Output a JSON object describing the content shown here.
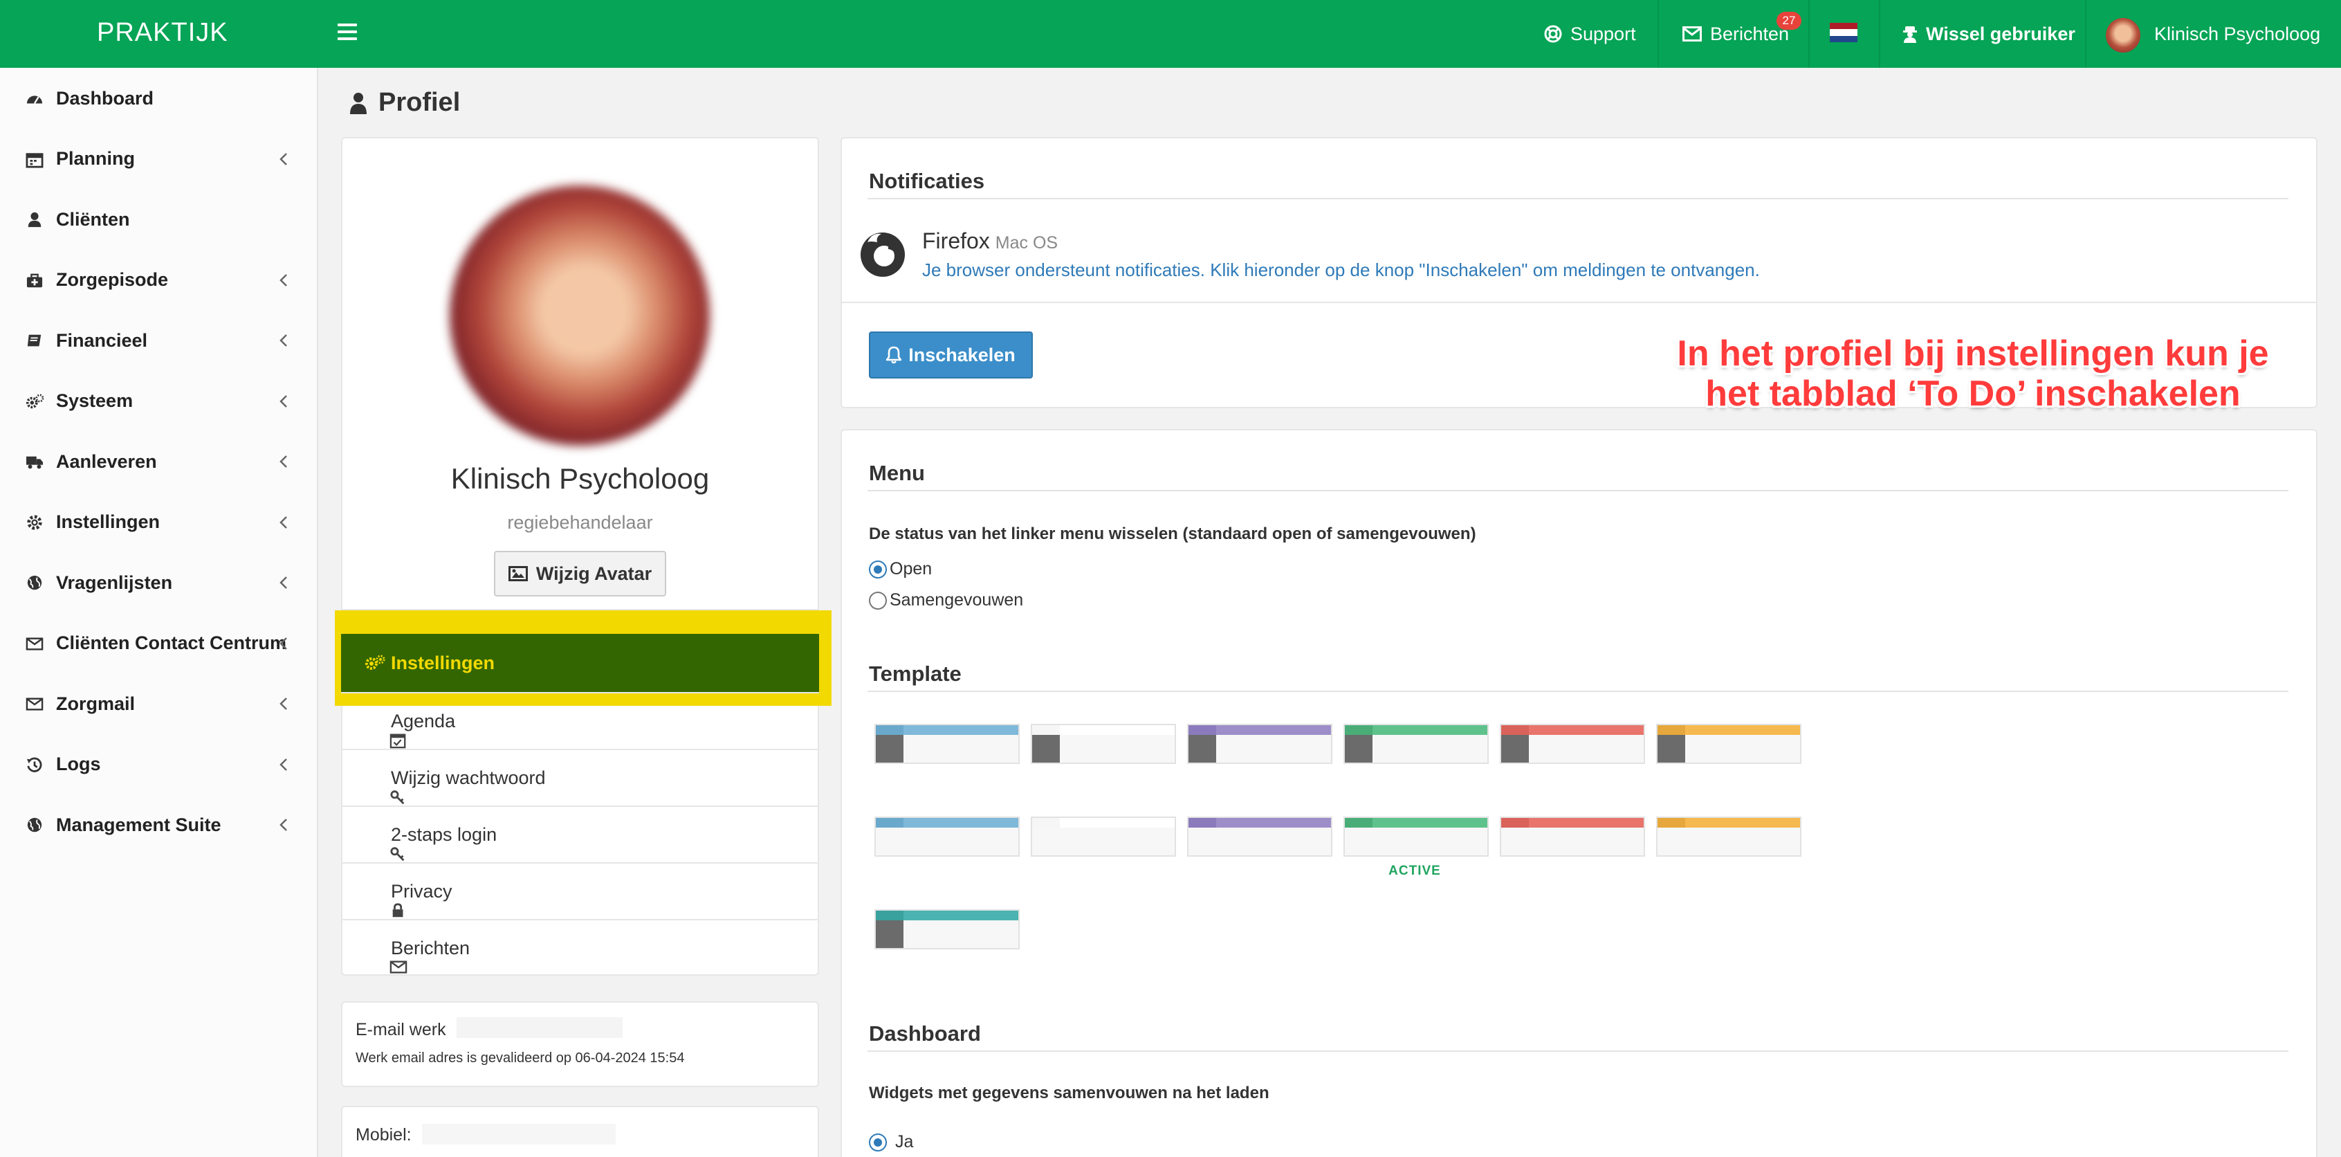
{
  "topbar": {
    "brand": "PRAKTIJK",
    "support_label": "Support",
    "messages_label": "Berichten",
    "messages_badge": "27",
    "switch_user_label": "Wissel gebruiker",
    "user_name": "Klinisch Psycholoog",
    "flag_colors": [
      "#ae1c28",
      "#ffffff",
      "#21468b"
    ]
  },
  "sidebar": {
    "items": [
      {
        "label": "Dashboard",
        "icon": "tachometer-icon",
        "has_chevron": false
      },
      {
        "label": "Planning",
        "icon": "calendar-icon",
        "has_chevron": true
      },
      {
        "label": "Cliënten",
        "icon": "user-icon",
        "has_chevron": false
      },
      {
        "label": "Zorgepisode",
        "icon": "medkit-icon",
        "has_chevron": true
      },
      {
        "label": "Financieel",
        "icon": "book-icon",
        "has_chevron": true
      },
      {
        "label": "Systeem",
        "icon": "cogs-icon",
        "has_chevron": true
      },
      {
        "label": "Aanleveren",
        "icon": "truck-icon",
        "has_chevron": true
      },
      {
        "label": "Instellingen",
        "icon": "gear-icon",
        "has_chevron": true
      },
      {
        "label": "Vragenlijsten",
        "icon": "globe-icon",
        "has_chevron": true
      },
      {
        "label": "Cliënten Contact Centrum",
        "icon": "envelope-icon",
        "has_chevron": true
      },
      {
        "label": "Zorgmail",
        "icon": "envelope-icon",
        "has_chevron": true
      },
      {
        "label": "Logs",
        "icon": "history-icon",
        "has_chevron": true
      },
      {
        "label": "Management Suite",
        "icon": "globe-icon",
        "has_chevron": true
      }
    ]
  },
  "page": {
    "title": "Profiel"
  },
  "profile": {
    "name": "Klinisch Psycholoog",
    "role": "regiebehandelaar",
    "change_avatar_label": "Wijzig Avatar",
    "menu_active": "Instellingen",
    "menu_items": [
      {
        "label": "Agenda",
        "icon": "calendar-check-icon"
      },
      {
        "label": "Wijzig wachtwoord",
        "icon": "key-icon"
      },
      {
        "label": "2-staps login",
        "icon": "key-icon"
      },
      {
        "label": "Privacy",
        "icon": "lock-icon"
      },
      {
        "label": "Berichten",
        "icon": "envelope-icon"
      }
    ],
    "email_label": "E-mail werk",
    "email_validated": "Werk email adres is gevalideerd op 06-04-2024 15:54",
    "mobile_label": "Mobiel:"
  },
  "notifications": {
    "title": "Notificaties",
    "browser": "Firefox",
    "os": "Mac OS",
    "message": "Je browser ondersteunt notificaties. Klik hieronder op de knop \"Inschakelen\" om meldingen te ontvangen.",
    "enable_label": "Inschakelen"
  },
  "annotation": {
    "line1": "In het profiel bij instellingen kun je",
    "line2": "het tabblad ‘To Do’ inschakelen"
  },
  "menu_settings": {
    "title": "Menu",
    "question": "De status van het linker menu wisselen (standaard open of samengevouwen)",
    "options": [
      "Open",
      "Samengevouwen"
    ],
    "selected": "Open"
  },
  "template": {
    "title": "Template",
    "active_label": "ACTIVE",
    "active_index": 10,
    "themes": [
      {
        "header": "#7fb8d8",
        "header_left": "#6aa9cc",
        "side": "#6b6b6b"
      },
      {
        "header": "#ffffff",
        "header_left": "#f6f6f6",
        "side": "#6b6b6b"
      },
      {
        "header": "#9d8ec9",
        "header_left": "#8b7bbd",
        "side": "#6b6b6b"
      },
      {
        "header": "#5fc28c",
        "header_left": "#4aad78",
        "side": "#6b6b6b"
      },
      {
        "header": "#e8746c",
        "header_left": "#d9625a",
        "side": "#6b6b6b"
      },
      {
        "header": "#f6b94f",
        "header_left": "#e6a73c",
        "side": "#6b6b6b"
      },
      {
        "header": "#7fb8d8",
        "header_left": "#6aa9cc",
        "side": "#f7f7f7"
      },
      {
        "header": "#ffffff",
        "header_left": "#f6f6f6",
        "side": "#f7f7f7"
      },
      {
        "header": "#9d8ec9",
        "header_left": "#8b7bbd",
        "side": "#f7f7f7"
      },
      {
        "header": "#5fc28c",
        "header_left": "#4aad78",
        "side": "#f7f7f7"
      },
      {
        "header": "#e8746c",
        "header_left": "#d9625a",
        "side": "#f7f7f7"
      },
      {
        "header": "#f6b94f",
        "header_left": "#e6a73c",
        "side": "#f7f7f7"
      },
      {
        "header": "#4cb3b0",
        "header_left": "#3aa19e",
        "side": "#6b6b6b"
      }
    ]
  },
  "dashboard_settings": {
    "title": "Dashboard",
    "question": "Widgets met gegevens samenvouwen na het laden",
    "options": [
      "Ja"
    ],
    "selected": "Ja"
  }
}
